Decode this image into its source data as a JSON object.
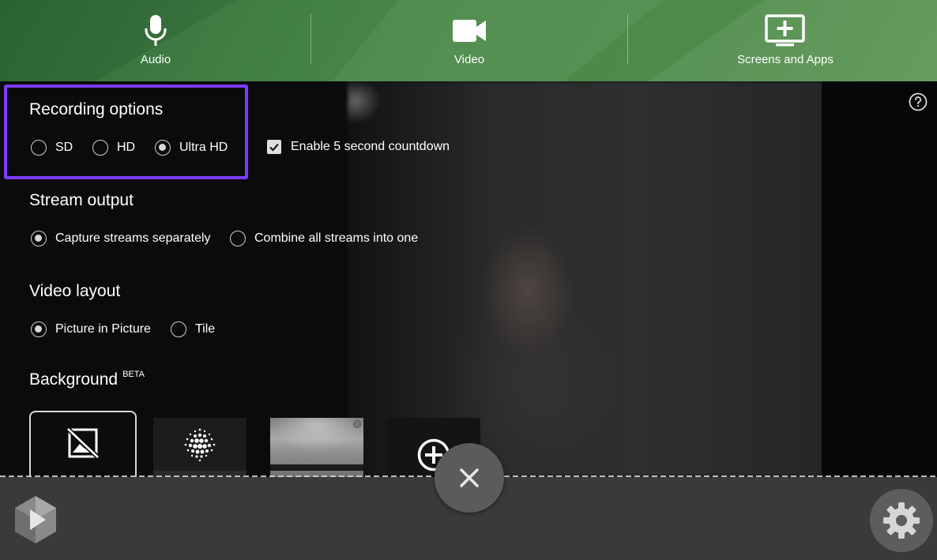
{
  "sources": {
    "audio": {
      "label": "Audio",
      "icon": "microphone-icon"
    },
    "video": {
      "label": "Video",
      "icon": "video-camera-icon"
    },
    "screens": {
      "label": "Screens and Apps",
      "icon": "monitor-plus-icon"
    }
  },
  "recording": {
    "title": "Recording options",
    "quality_options": [
      {
        "label": "SD",
        "selected": false
      },
      {
        "label": "HD",
        "selected": false
      },
      {
        "label": "Ultra HD",
        "selected": true
      }
    ],
    "countdown": {
      "label": "Enable 5 second countdown",
      "checked": true
    }
  },
  "stream_output": {
    "title": "Stream output",
    "options": [
      {
        "label": "Capture streams separately",
        "selected": true
      },
      {
        "label": "Combine all streams into one",
        "selected": false
      }
    ]
  },
  "video_layout": {
    "title": "Video layout",
    "options": [
      {
        "label": "Picture in Picture",
        "selected": true
      },
      {
        "label": "Tile",
        "selected": false
      }
    ]
  },
  "background": {
    "title": "Background",
    "badge": "BETA",
    "thumbnails": [
      {
        "icon": "no-image-icon",
        "selected": true
      },
      {
        "icon": "blur-dots-icon",
        "selected": false
      },
      {
        "icon": "room-image",
        "selected": false
      },
      {
        "icon": "add-circle-icon",
        "selected": false
      }
    ]
  },
  "colors": {
    "topbar_green": "#4b8a48",
    "highlight_purple": "#7a3cff",
    "bottombar": "#3a3a3a"
  },
  "controls": {
    "help_icon": "question-circle-icon",
    "close_icon": "close-icon",
    "settings_icon": "gear-icon",
    "logo": "panopto-logo"
  }
}
